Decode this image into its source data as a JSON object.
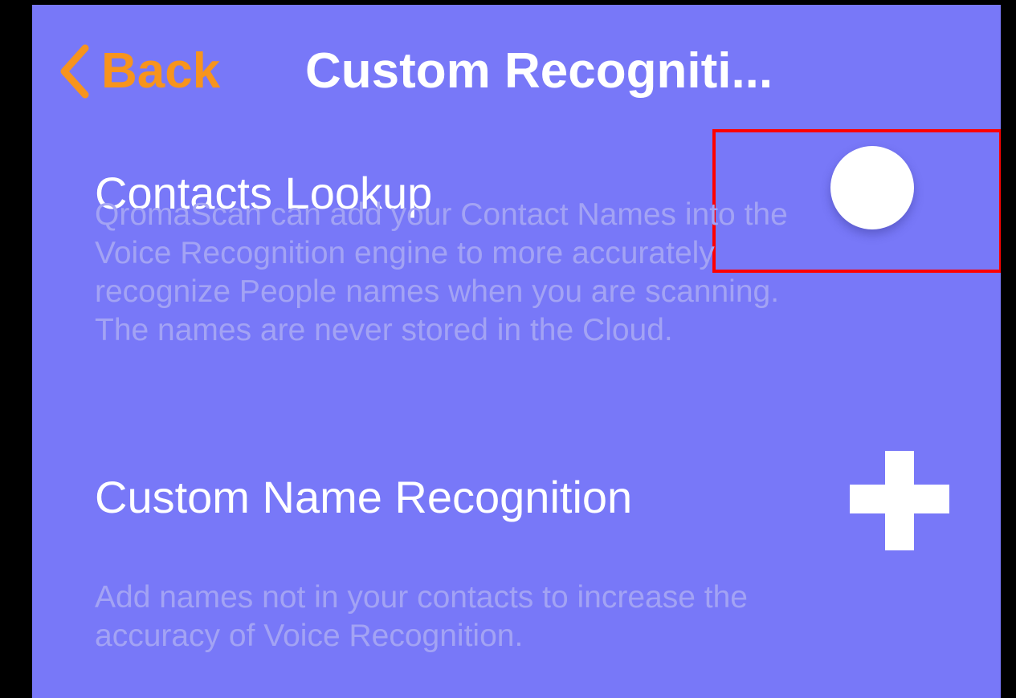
{
  "colors": {
    "background": "#7878F8",
    "accent": "#F7941D",
    "title_text": "#FFFFFF",
    "description_text": "#A3A3F4",
    "highlight_box": "#FF0000"
  },
  "nav": {
    "back_icon": "chevron-left-icon",
    "back_label": "Back",
    "title": "Custom Recogniti..."
  },
  "contacts_lookup": {
    "title": "Contacts Lookup",
    "toggle_on": false,
    "description_lines": [
      "QromaScan can add your Contact Names into the",
      "Voice Recognition engine to more accurately",
      "recognize People names when you are scanning.",
      "The names are never stored in the Cloud."
    ]
  },
  "custom_name": {
    "title": "Custom Name Recognition",
    "add_icon": "plus-icon",
    "description_lines": [
      "Add names not in your contacts to increase the",
      "accuracy of Voice Recognition."
    ]
  }
}
